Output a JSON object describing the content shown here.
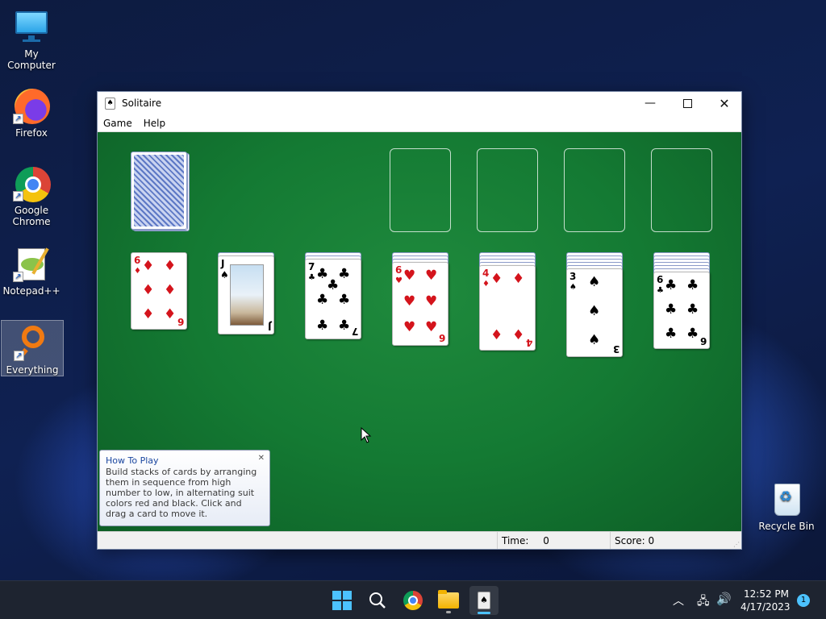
{
  "desktop": {
    "icons": [
      {
        "label": "My Computer",
        "icon": "monitor-icon"
      },
      {
        "label": "Firefox",
        "icon": "firefox-icon"
      },
      {
        "label": "Google Chrome",
        "icon": "chrome-icon"
      },
      {
        "label": "Notepad++",
        "icon": "notepadpp-icon"
      },
      {
        "label": "Everything",
        "icon": "everything-search-icon"
      },
      {
        "label": "Recycle Bin",
        "icon": "recycle-bin-icon"
      }
    ]
  },
  "window": {
    "title": "Solitaire",
    "menu": [
      "Game",
      "Help"
    ],
    "status": {
      "time_label": "Time:",
      "time_value": "0",
      "score_label": "Score: 0"
    }
  },
  "game": {
    "stock": "face-down deck",
    "foundations": [
      "empty",
      "empty",
      "empty",
      "empty"
    ],
    "tableau": [
      {
        "hidden": 0,
        "top": {
          "rank": "6",
          "suit": "diamonds",
          "color": "red"
        }
      },
      {
        "hidden": 1,
        "top": {
          "rank": "J",
          "suit": "spades",
          "color": "black"
        }
      },
      {
        "hidden": 2,
        "top": {
          "rank": "7",
          "suit": "clubs",
          "color": "black"
        }
      },
      {
        "hidden": 3,
        "top": {
          "rank": "6",
          "suit": "hearts",
          "color": "red"
        }
      },
      {
        "hidden": 4,
        "top": {
          "rank": "4",
          "suit": "diamonds",
          "color": "red"
        }
      },
      {
        "hidden": 5,
        "top": {
          "rank": "3",
          "suit": "spades",
          "color": "black"
        }
      },
      {
        "hidden": 6,
        "top": {
          "rank": "6",
          "suit": "clubs",
          "color": "black"
        }
      }
    ]
  },
  "tooltip": {
    "title": "How To Play",
    "body": "Build stacks of cards by arranging them in sequence from high number to low, in alternating suit colors red and black. Click and drag a card to move it."
  },
  "taskbar": {
    "apps": [
      "start-icon",
      "search-icon",
      "chrome-icon",
      "file-explorer-icon",
      "solitaire-icon"
    ],
    "clock_time": "12:52 PM",
    "clock_date": "4/17/2023",
    "notification_count": "1"
  }
}
